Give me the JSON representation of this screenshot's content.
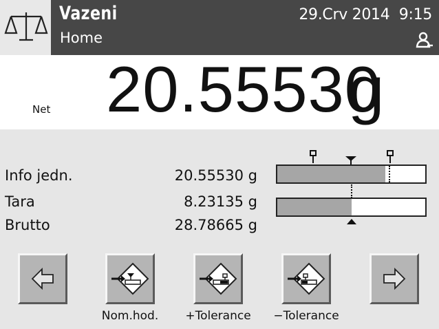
{
  "header": {
    "logo_icon": "balance-scale-icon",
    "title": "Vazeni",
    "subtitle": "Home",
    "datetime": "29.Crv 2014  9:15",
    "user_icon": "user-icon"
  },
  "weight": {
    "label": "Net",
    "value": "20.55530",
    "unit": "g"
  },
  "info": [
    {
      "label": "Info jedn.",
      "value": "20.55530 g"
    },
    {
      "label": "Tara",
      "value": "8.23135 g"
    },
    {
      "label": "Brutto",
      "value": "28.78665 g"
    }
  ],
  "tolerance_bar": {
    "fill_fraction": 0.73
  },
  "capacity_bar": {
    "fill_fraction": 0.5
  },
  "softkeys": [
    {
      "icon": "arrow-left-icon",
      "label": ""
    },
    {
      "icon": "nominal-value-icon",
      "label": "Nom.hod."
    },
    {
      "icon": "plus-tolerance-icon",
      "label": "+Tolerance"
    },
    {
      "icon": "minus-tolerance-icon",
      "label": "−Tolerance"
    },
    {
      "icon": "arrow-right-icon",
      "label": ""
    }
  ],
  "colors": {
    "header_bg": "#474747",
    "bar_fill": "#a6a6a6",
    "button_face": "#b5b5b5"
  }
}
